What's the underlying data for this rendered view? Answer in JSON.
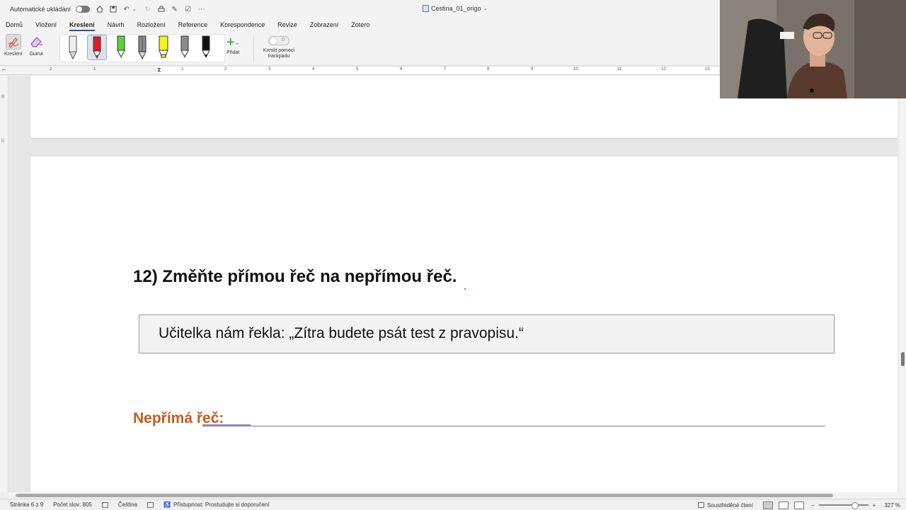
{
  "titlebar": {
    "autosave_label": "Automatické ukládání",
    "document_name": "Cestina_01_origo"
  },
  "menu": {
    "tabs": [
      {
        "label": "Domů"
      },
      {
        "label": "Vložení"
      },
      {
        "label": "Kreslení"
      },
      {
        "label": "Návrh"
      },
      {
        "label": "Rozložení"
      },
      {
        "label": "Reference"
      },
      {
        "label": "Korespondence"
      },
      {
        "label": "Revize"
      },
      {
        "label": "Zobrazení"
      },
      {
        "label": "Zotero"
      }
    ],
    "active_tab": "Kreslení"
  },
  "ribbon": {
    "draw_label": "Kreslení",
    "eraser_label": "Guma",
    "add_label": "Přidat",
    "trackpad_label": "Kreslit pomocí trackpadu",
    "trackpad_toggle_value": "0",
    "pens": [
      {
        "name": "pencil-gray",
        "color": "#bdbdbd"
      },
      {
        "name": "pen-red",
        "color": "#e0192b"
      },
      {
        "name": "pen-green",
        "color": "#5fd03a"
      },
      {
        "name": "pencil-dark",
        "color": "#6a6a6a"
      },
      {
        "name": "highlighter-yellow",
        "color": "#f3f31a"
      },
      {
        "name": "pen-gray",
        "color": "#8c8c8c"
      },
      {
        "name": "pen-black",
        "color": "#111111"
      }
    ]
  },
  "ruler": {
    "labels": [
      "2",
      "1",
      "1",
      "2",
      "3",
      "4",
      "5",
      "6",
      "7",
      "8",
      "9",
      "10",
      "11",
      "12",
      "13"
    ],
    "vertical_labels": [
      "26",
      "27"
    ]
  },
  "document": {
    "task_heading": "12) Změňte přímou řeč na nepřímou řeč.",
    "quote_text": "Učitelka nám řekla: „Zítra budete psát test z pravopisu.“",
    "answer_label": "Nepřímá řeč:",
    "accent_color": "#c65a1e"
  },
  "statusbar": {
    "page": "Stránka 6 z 9",
    "word_count": "Počet slov: 805",
    "language": "Čeština",
    "accessibility": "Přístupnost: Prostudujte si doporučení",
    "focus_mode": "Soustředěné čtení",
    "zoom": "327 %"
  }
}
